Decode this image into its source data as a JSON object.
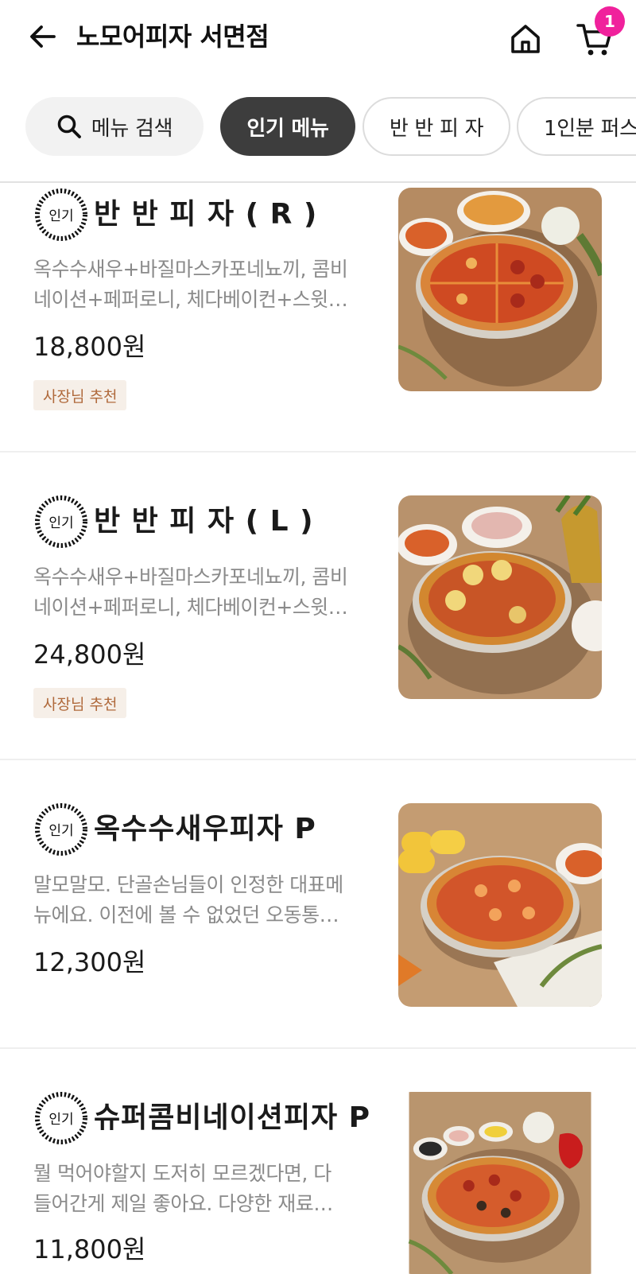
{
  "header": {
    "title": "노모어피자 서면점",
    "cart_count": "1"
  },
  "tabs": {
    "search_label": "메뉴 검색",
    "items": [
      "인기 메뉴",
      "반 반 피 자",
      "1인분 퍼스"
    ]
  },
  "badge_text": "인기",
  "menu": [
    {
      "name": "반 반 피 자 ( R )",
      "desc_line1": "옥수수새우+바질마스카포네뇨끼, 콤비",
      "desc_line2": "네이션+페퍼로니, 체다베이컨+스윗…",
      "price": "18,800원",
      "tag": "사장님 추천"
    },
    {
      "name": "반 반 피 자 ( L )",
      "desc_line1": "옥수수새우+바질마스카포네뇨끼, 콤비",
      "desc_line2": "네이션+페퍼로니, 체다베이컨+스윗…",
      "price": "24,800원",
      "tag": "사장님 추천"
    },
    {
      "name": "옥수수새우피자 P",
      "desc_line1": "말모말모. 단골손님들이 인정한 대표메",
      "desc_line2": "뉴에요. 이전에 볼 수 없었던 오동통…",
      "price": "12,300원"
    },
    {
      "name": "슈퍼콤비네이션피자 P",
      "desc_line1": "뭘 먹어야할지 도저히 모르겠다면, 다",
      "desc_line2": "들어간게 제일 좋아요. 다양한 재료…",
      "price": "11,800원"
    }
  ],
  "colors": {
    "accent_badge": "#f0219c",
    "active_tab": "#3d3d3d",
    "owner_tag_bg": "#f6efe8",
    "owner_tag_text": "#b06a3c"
  }
}
